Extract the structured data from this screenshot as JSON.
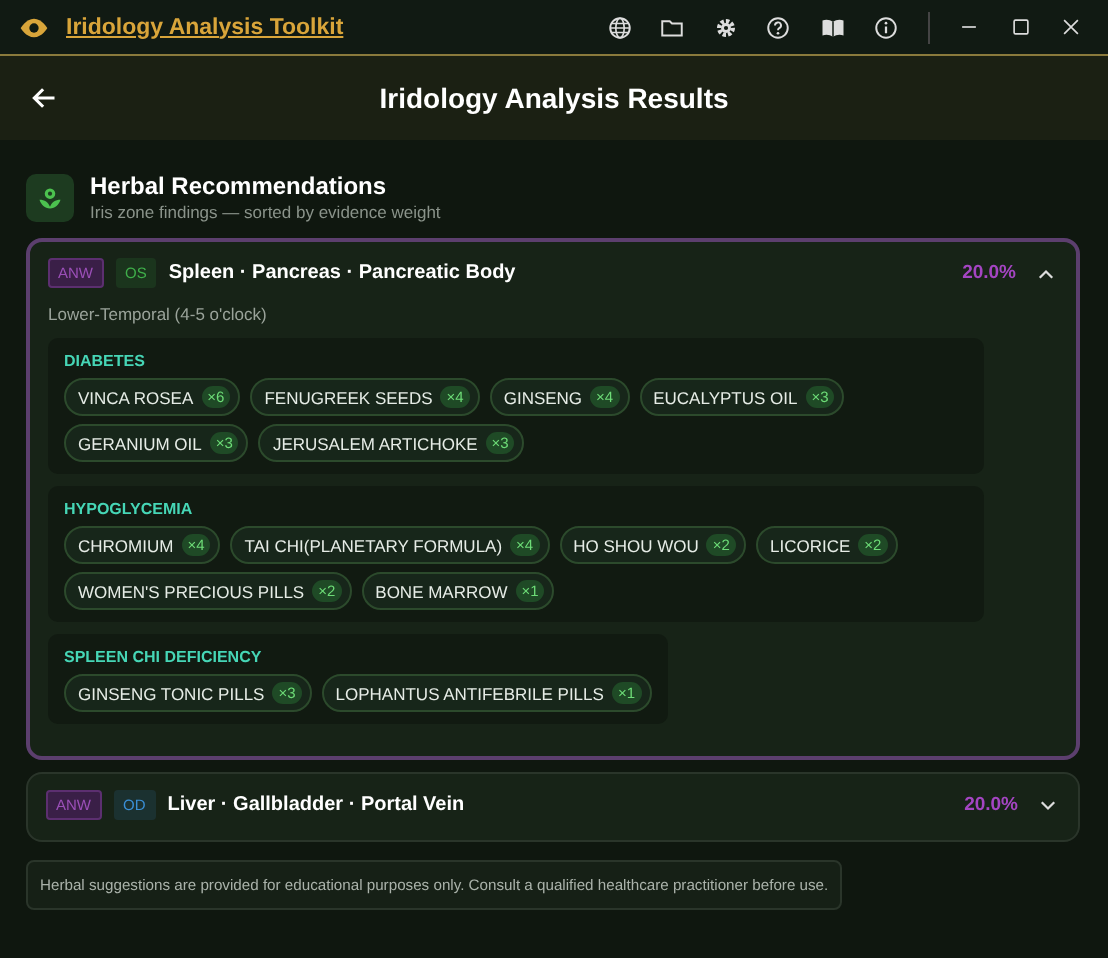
{
  "window": {
    "title": "Iridology Analysis Toolkit"
  },
  "header": {
    "title": "Iridology Analysis Results"
  },
  "section": {
    "title": "Herbal Recommendations",
    "subtitle": "Iris zone findings — sorted by evidence weight"
  },
  "zones": [
    {
      "tag": "ANW",
      "eye": "OS",
      "color": "#3fae4a",
      "name": "Spleen · Pancreas · Pancreatic Body",
      "percent": "20.0%",
      "expanded": true,
      "location": "Lower-Temporal (4-5 o'clock)",
      "conditions": [
        {
          "name": "DIABETES",
          "herbs": [
            {
              "name": "VINCA ROSEA",
              "count": "×6"
            },
            {
              "name": "FENUGREEK SEEDS",
              "count": "×4"
            },
            {
              "name": "GINSENG",
              "count": "×4"
            },
            {
              "name": "EUCALYPTUS OIL",
              "count": "×3"
            },
            {
              "name": "GERANIUM OIL",
              "count": "×3"
            },
            {
              "name": "JERUSALEM ARTICHOKE",
              "count": "×3"
            }
          ]
        },
        {
          "name": "HYPOGLYCEMIA",
          "herbs": [
            {
              "name": "CHROMIUM",
              "count": "×4"
            },
            {
              "name": "TAI CHI(PLANETARY FORMULA)",
              "count": "×4"
            },
            {
              "name": "HO SHOU WOU",
              "count": "×2"
            },
            {
              "name": "LICORICE",
              "count": "×2"
            },
            {
              "name": "WOMEN'S PRECIOUS PILLS",
              "count": "×2"
            },
            {
              "name": "BONE MARROW",
              "count": "×1"
            }
          ]
        },
        {
          "name": "SPLEEN CHI DEFICIENCY",
          "herbs": [
            {
              "name": "GINSENG TONIC PILLS",
              "count": "×3"
            },
            {
              "name": "LOPHANTUS ANTIFEBRILE PILLS",
              "count": "×1"
            }
          ]
        }
      ]
    },
    {
      "tag": "ANW",
      "eye": "OD",
      "color": "#3a8fd6",
      "name": "Liver · Gallbladder · Portal Vein",
      "percent": "20.0%",
      "expanded": false
    }
  ],
  "note": "Herbal suggestions are provided for educational purposes only. Consult a qualified healthcare practitioner before use."
}
